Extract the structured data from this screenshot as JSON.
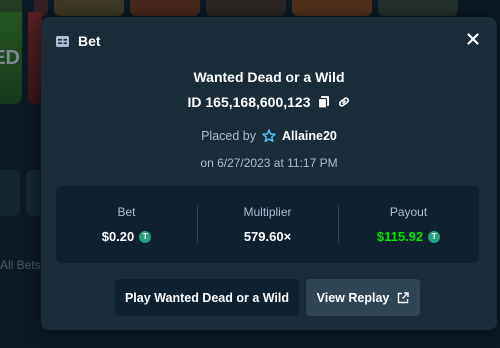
{
  "background": {
    "card_left_text": "ED",
    "all_bets_label": "All Bets"
  },
  "modal": {
    "title": "Bet",
    "title_icon": "ticket-icon",
    "close_icon": "close-icon",
    "game_name": "Wanted Dead or a Wild",
    "bet_id": "ID 165,168,600,123",
    "copy_icon": "copy-icon",
    "link_icon": "link-icon",
    "placed_by_label": "Placed by",
    "vip_icon": "vip-star-icon",
    "username": "Allaine20",
    "date_text": "on 6/27/2023 at 11:17 PM",
    "stats": {
      "bet_label": "Bet",
      "bet_value": "$0.20",
      "multiplier_label": "Multiplier",
      "multiplier_value": "579.60×",
      "payout_label": "Payout",
      "payout_value": "$115.92",
      "currency_icon": "tether-coin-icon",
      "currency_symbol": "T"
    },
    "play_button_label": "Play Wanted Dead or a Wild",
    "replay_button_label": "View Replay",
    "replay_icon": "external-link-icon"
  },
  "colors": {
    "background": "#0f212e",
    "modal": "#1a2c38",
    "muted_text": "#b1bad3",
    "payout_green": "#00e701",
    "tether": "#26a17b",
    "secondary_button": "#2f4553"
  }
}
